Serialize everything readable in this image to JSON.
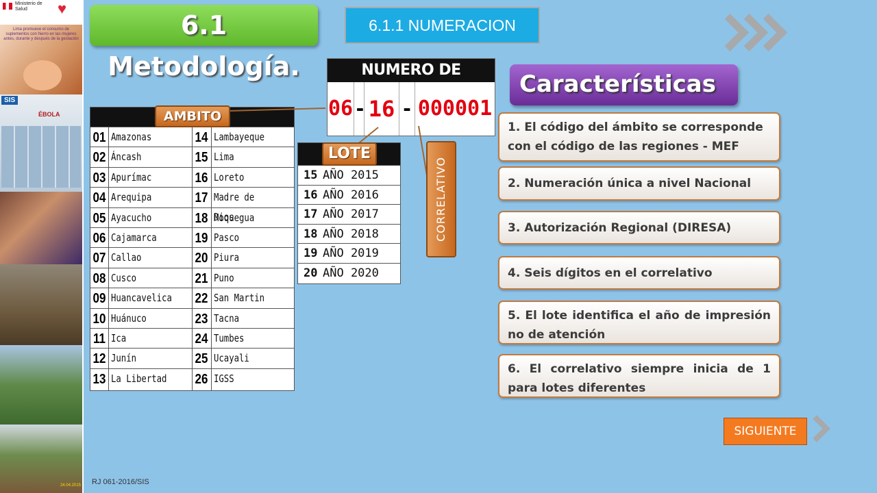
{
  "header": {
    "title": "6.1 Metodología.",
    "subtitle_button": "6.1.1 NUMERACION"
  },
  "left_strip": {
    "ministry_text": "Ministerio de Salud",
    "campaign_caption": "Lima promueve el consumo de suplementos con hierro en las mujeres antes, durante y después de la gestación",
    "sis_label": "SIS",
    "ebola_label": "ÉBOLA",
    "photo_date": "24.04.2015"
  },
  "formato": {
    "header": "NUMERO DE FORMATO",
    "ambito_code": "06",
    "separator1": "-",
    "lote_code": "16",
    "separator2": "-",
    "correlativo_code": "000001"
  },
  "caracteristicas": {
    "title": "Características",
    "items": [
      "1. El código del ámbito se corresponde con el código de las regiones - MEF",
      "2. Numeración única a nivel Nacional",
      "3. Autorización Regional (DIRESA)",
      "4. Seis dígitos en el correlativo",
      "5. El lote identifica el año de impresión no de atención",
      "6. El correlativo siempre inicia de 1 para lotes diferentes"
    ]
  },
  "ambito": {
    "tag": "AMBITO",
    "left": [
      {
        "num": "01",
        "name": "Amazonas"
      },
      {
        "num": "02",
        "name": "Áncash"
      },
      {
        "num": "03",
        "name": "Apurímac"
      },
      {
        "num": "04",
        "name": "Arequipa"
      },
      {
        "num": "05",
        "name": "Ayacucho"
      },
      {
        "num": "06",
        "name": "Cajamarca"
      },
      {
        "num": "07",
        "name": "Callao"
      },
      {
        "num": "08",
        "name": "Cusco"
      },
      {
        "num": "09",
        "name": "Huancavelica"
      },
      {
        "num": "10",
        "name": "Huánuco"
      },
      {
        "num": "11",
        "name": "Ica"
      },
      {
        "num": "12",
        "name": "Junín"
      },
      {
        "num": "13",
        "name": "La Libertad"
      }
    ],
    "right": [
      {
        "num": "14",
        "name": "Lambayeque"
      },
      {
        "num": "15",
        "name": "Lima"
      },
      {
        "num": "16",
        "name": "Loreto"
      },
      {
        "num": "17",
        "name": "Madre de Dios"
      },
      {
        "num": "18",
        "name": "Moquegua"
      },
      {
        "num": "19",
        "name": "Pasco"
      },
      {
        "num": "20",
        "name": "Piura"
      },
      {
        "num": "21",
        "name": "Puno"
      },
      {
        "num": "22",
        "name": "San Martin"
      },
      {
        "num": "23",
        "name": "Tacna"
      },
      {
        "num": "24",
        "name": "Tumbes"
      },
      {
        "num": "25",
        "name": "Ucayali"
      },
      {
        "num": "26",
        "name": "IGSS"
      }
    ]
  },
  "lote": {
    "tag": "LOTE",
    "rows": [
      {
        "num": "15",
        "text": "AÑO 2015"
      },
      {
        "num": "16",
        "text": "AÑO 2016"
      },
      {
        "num": "17",
        "text": "AÑO 2017"
      },
      {
        "num": "18",
        "text": "AÑO 2018"
      },
      {
        "num": "19",
        "text": "AÑO 2019"
      },
      {
        "num": "20",
        "text": "AÑO 2020"
      }
    ]
  },
  "correlativo_label": "CORRELATIVO",
  "siguiente_label": "SIGUIENTE",
  "footer_ref": "RJ 061-2016/SIS",
  "colors": {
    "background": "#8ec3e8",
    "title_green": "#6fc23a",
    "numeracion_blue": "#1dabe3",
    "carac_purple": "#7b3aa8",
    "tag_orange": "#d2782e",
    "code_red": "#e3000f",
    "siguiente_orange": "#f47a20"
  },
  "icons": {
    "decor_chevrons": "triple-chevron-right-icon",
    "next_chevron": "chevron-right-icon"
  }
}
